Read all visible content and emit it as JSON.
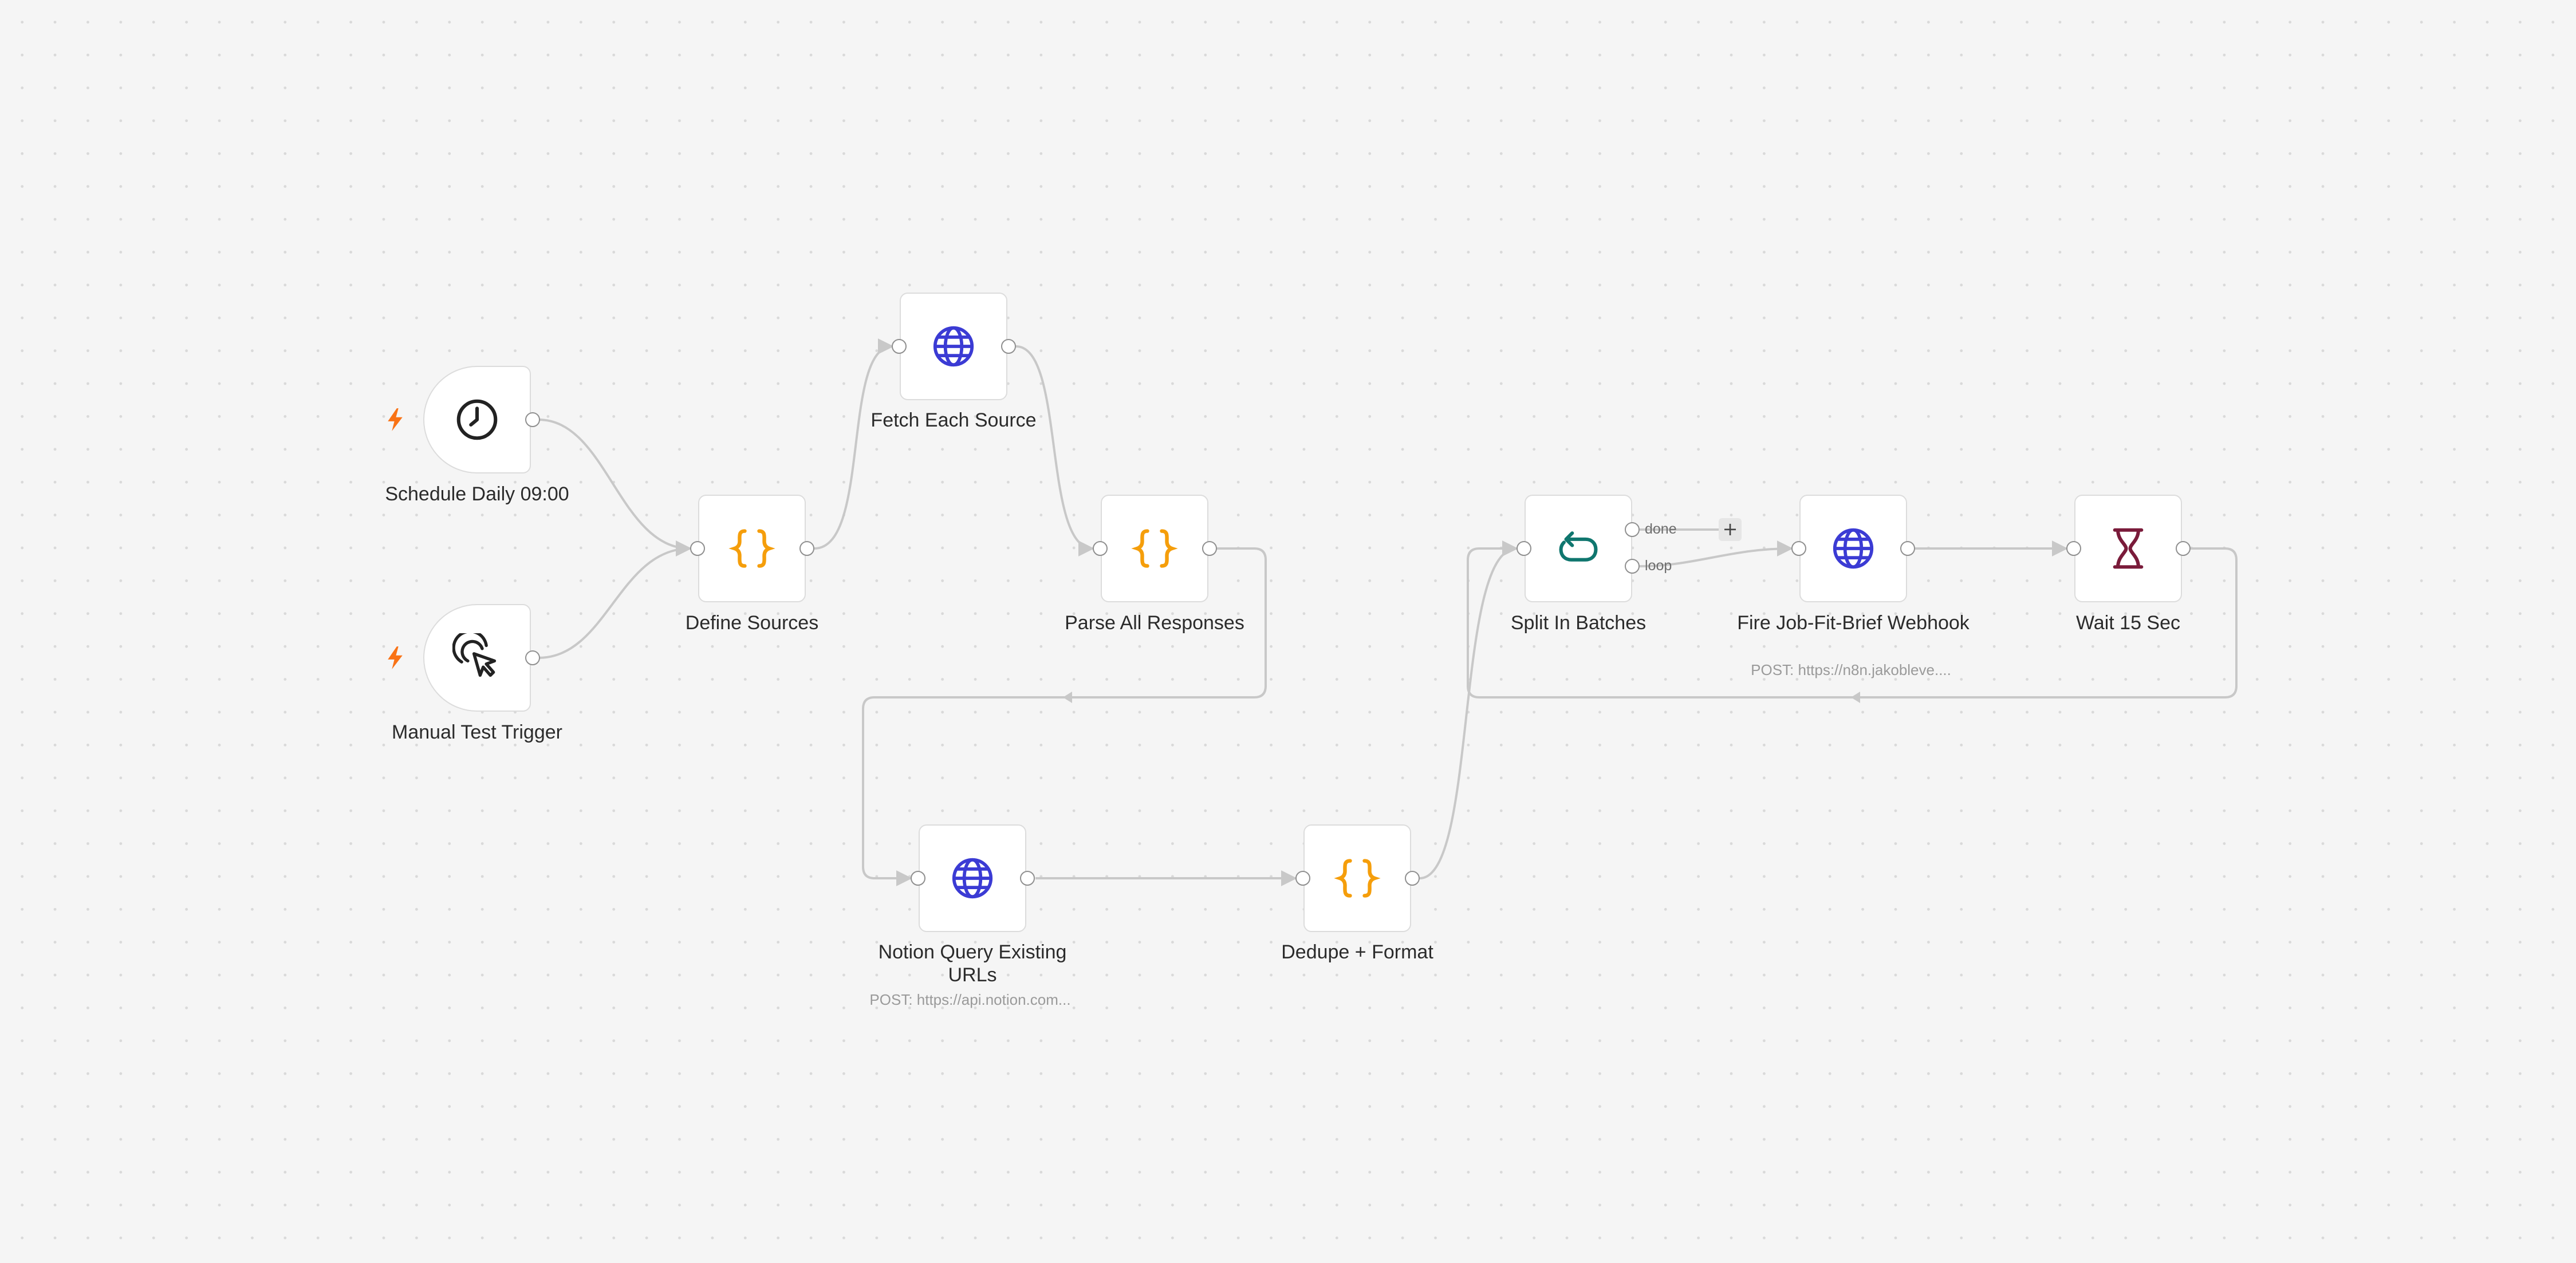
{
  "nodes": {
    "schedule": {
      "label": "Schedule Daily 09:00",
      "icon": "clock-icon"
    },
    "manual": {
      "label": "Manual Test Trigger",
      "icon": "cursor-click-icon"
    },
    "define_sources": {
      "label": "Define Sources",
      "icon": "code-braces-icon"
    },
    "fetch_each": {
      "label": "Fetch Each Source",
      "icon": "globe-icon"
    },
    "parse_all": {
      "label": "Parse All Responses",
      "icon": "code-braces-icon"
    },
    "notion_query": {
      "label": "Notion Query Existing URLs",
      "sublabel": "POST: https://api.notion.com...",
      "icon": "globe-icon"
    },
    "dedupe": {
      "label": "Dedupe + Format",
      "icon": "code-braces-icon"
    },
    "split_batches": {
      "label": "Split In Batches",
      "icon": "loop-arrow-icon",
      "port_done": "done",
      "port_loop": "loop"
    },
    "fire_webhook": {
      "label": "Fire Job-Fit-Brief Webhook",
      "sublabel": "POST: https://n8n.jakobleve....",
      "icon": "globe-icon"
    },
    "wait": {
      "label": "Wait 15 Sec",
      "icon": "hourglass-icon"
    }
  },
  "add_button": "+",
  "colors": {
    "code": "#f59e0b",
    "http": "#3b3bd4",
    "split": "#0f766e",
    "wait": "#7a1b3a",
    "trigger_bolt": "#f97316",
    "wire": "#c8c8c8"
  }
}
